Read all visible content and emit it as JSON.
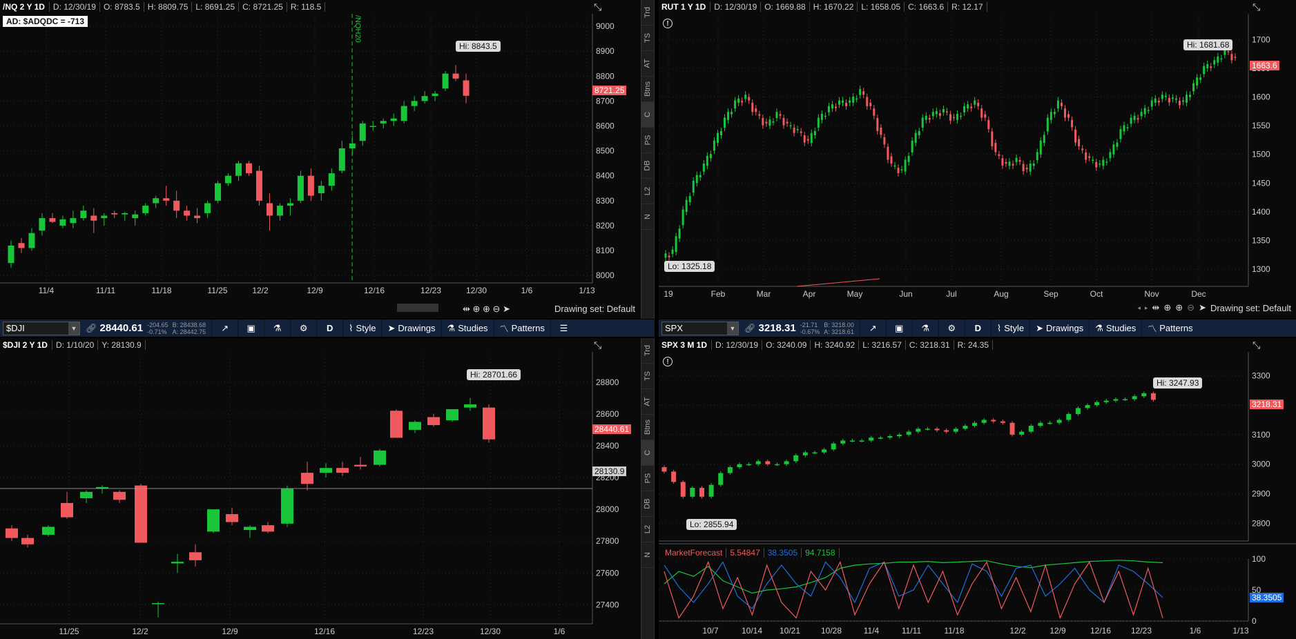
{
  "colors": {
    "up": "#19c63a",
    "down": "#f05a5f",
    "bg": "#0a0a0a",
    "grid": "#2a2a2a",
    "toolbar": "#13223a",
    "forecast_red": "#f05a5f",
    "forecast_blue": "#1e6fe0",
    "forecast_green": "#19c63a"
  },
  "sidebar_tabs": [
    "Trd",
    "TS",
    "AT",
    "Btns",
    "C",
    "PS",
    "DB",
    "L2",
    "N"
  ],
  "panels": {
    "nq": {
      "symbol": "/NQ 2 Y 1D",
      "fields": [
        "D: 12/30/19",
        "O: 8783.5",
        "H: 8809.75",
        "L: 8691.25",
        "C: 8721.25",
        "R: 118.5"
      ],
      "ad_label": "AD: $ADQDC = -713",
      "expiry_label": "/NQH20",
      "hi_label": "Hi: 8843.5",
      "last_price": "8721.25",
      "y_ticks": [
        "9000",
        "8900",
        "8800",
        "8700",
        "8600",
        "8500",
        "8400",
        "8300",
        "8200",
        "8100",
        "8000"
      ],
      "x_ticks": [
        "11/4",
        "11/11",
        "11/18",
        "11/25",
        "12/2",
        "12/9",
        "12/16",
        "12/23",
        "12/30",
        "1/6",
        "1/13"
      ],
      "drawing_set": "Drawing set: Default"
    },
    "rut": {
      "symbol": "RUT 1 Y 1D",
      "fields": [
        "D: 12/30/19",
        "O: 1669.88",
        "H: 1670.22",
        "L: 1658.05",
        "C: 1663.6",
        "R: 12.17"
      ],
      "hi_label": "Hi: 1681.68",
      "lo_label": "Lo: 1325.18",
      "last_price": "1663.6",
      "y_ticks": [
        "1700",
        "1650",
        "1600",
        "1550",
        "1500",
        "1450",
        "1400",
        "1350",
        "1300"
      ],
      "x_ticks": [
        "19",
        "Feb",
        "Mar",
        "Apr",
        "May",
        "Jun",
        "Jul",
        "Aug",
        "Sep",
        "Oct",
        "Nov",
        "Dec"
      ],
      "drawing_set": "Drawing set: Default"
    },
    "dji": {
      "toolbar_symbol": "$DJI",
      "price": "28440.61",
      "change": "-204.65",
      "change_pct": "-0.71%",
      "bid": "B: 28438.68",
      "ask": "A: 28442.75",
      "symbol": "$DJI 2 Y 1D",
      "fields": [
        "D: 1/10/20",
        "Y: 28130.9"
      ],
      "hi_label": "Hi: 28701.66",
      "last_price": "28440.61",
      "crosshair_price": "28130.9",
      "y_ticks": [
        "28800",
        "28600",
        "28400",
        "28200",
        "28000",
        "27800",
        "27600",
        "27400"
      ],
      "x_ticks": [
        "11/25",
        "12/2",
        "12/9",
        "12/16",
        "12/23",
        "12/30",
        "1/6"
      ]
    },
    "spx": {
      "toolbar_symbol": "SPX",
      "price": "3218.31",
      "change": "-21.71",
      "change_pct": "-0.67%",
      "bid": "B: 3218.00",
      "ask": "A: 3218.61",
      "symbol": "SPX 3 M 1D",
      "fields": [
        "D: 12/30/19",
        "O: 3240.09",
        "H: 3240.92",
        "L: 3216.57",
        "C: 3218.31",
        "R: 24.35"
      ],
      "hi_label": "Hi: 3247.93",
      "lo_label": "Lo: 2855.94",
      "last_price": "3218.31",
      "y_ticks": [
        "3300",
        "3200",
        "3100",
        "3000",
        "2900",
        "2800"
      ],
      "x_ticks": [
        "10/7",
        "10/14",
        "10/21",
        "10/28",
        "11/4",
        "11/11",
        "11/18",
        "12/2",
        "12/9",
        "12/16",
        "12/23",
        "1/6",
        "1/13"
      ],
      "study_name": "MarketForecast",
      "study_values": [
        "5.54847",
        "38.3505",
        "94.7158"
      ],
      "study_ticks": [
        "100",
        "50",
        "0"
      ],
      "study_last": "38.3505"
    }
  },
  "toolbar": {
    "period": "D",
    "style": "Style",
    "drawings": "Drawings",
    "studies": "Studies",
    "patterns": "Patterns",
    "menu": "☰"
  }
}
